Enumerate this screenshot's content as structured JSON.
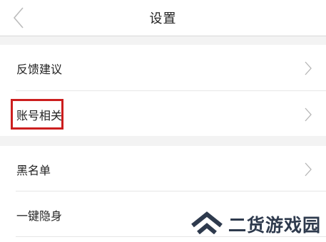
{
  "header": {
    "title": "设置"
  },
  "menu": [
    {
      "label": "反馈建议"
    },
    {
      "label": "账号相关"
    },
    {
      "label": "黑名单"
    },
    {
      "label": "一键隐身"
    }
  ],
  "colors": {
    "highlight": "#cc1e1e",
    "separator": "#f3f3f3",
    "watermark": "#2e3a4d"
  },
  "watermark": {
    "text": "二货游戏园"
  }
}
